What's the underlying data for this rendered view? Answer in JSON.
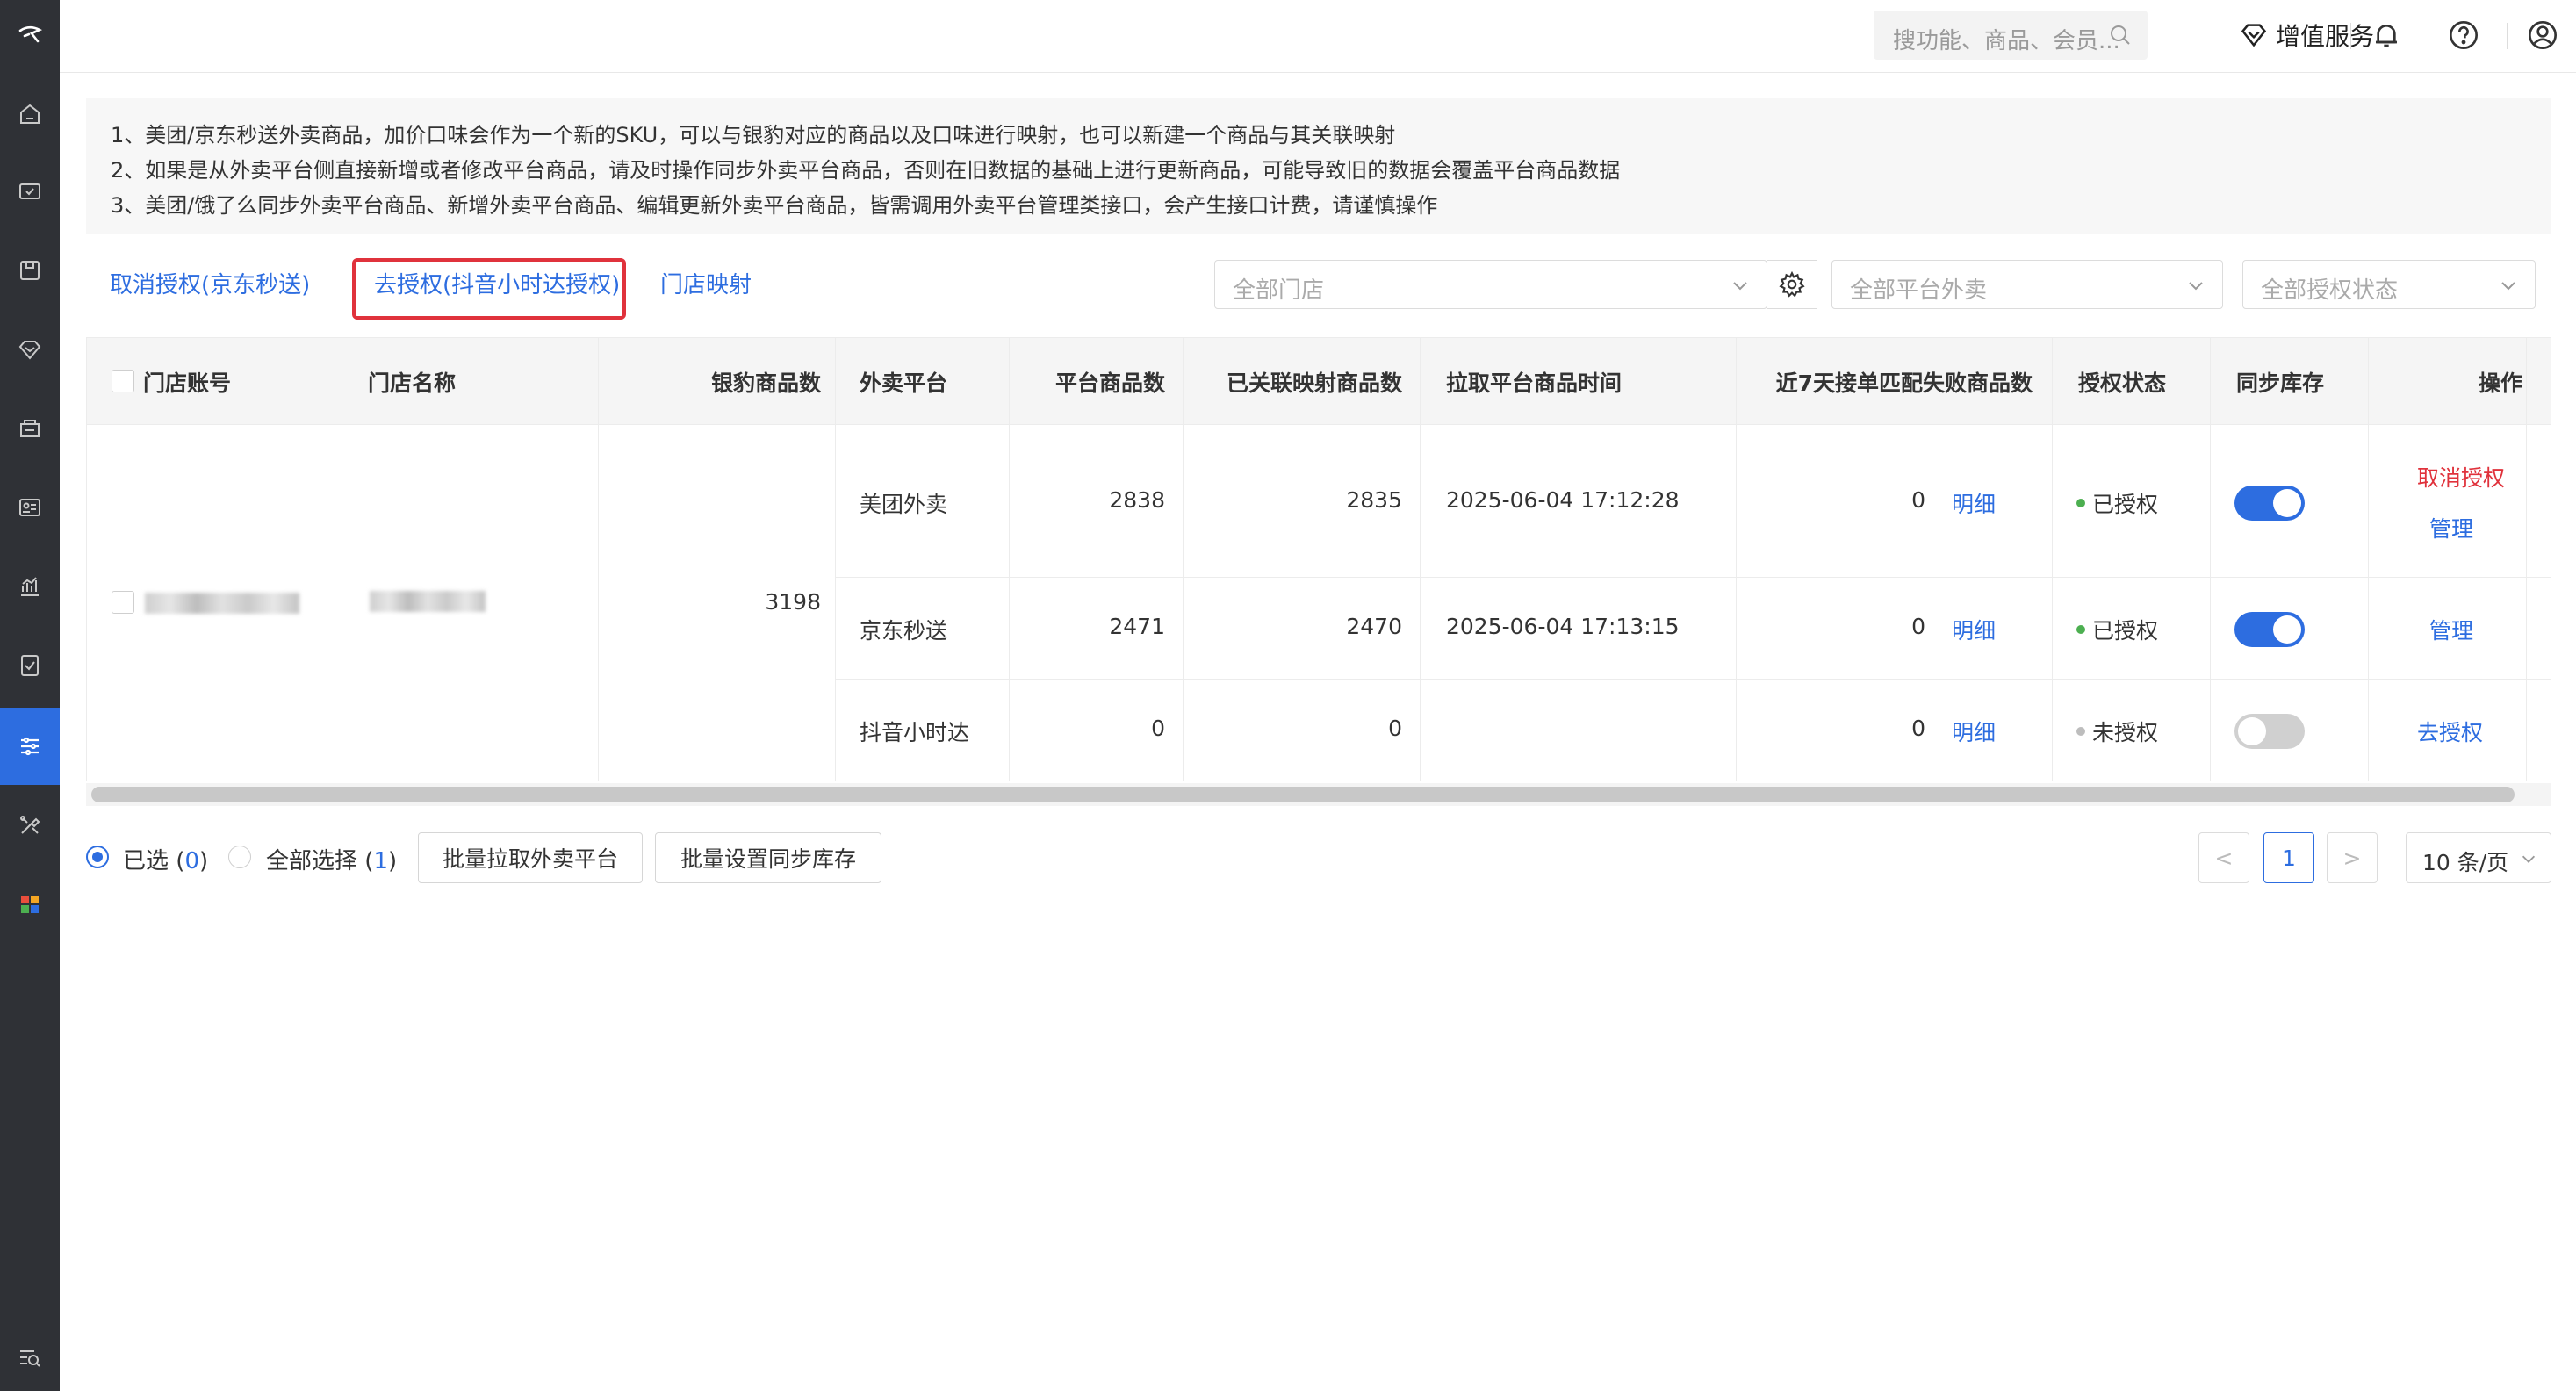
{
  "topbar": {
    "search_placeholder": "搜功能、商品、会员...",
    "value_added_label": "增值服务"
  },
  "notice": {
    "lines": [
      "1、美团/京东秒送外卖商品，加价口味会作为一个新的SKU，可以与银豹对应的商品以及口味进行映射，也可以新建一个商品与其关联映射",
      "2、如果是从外卖平台侧直接新增或者修改平台商品，请及时操作同步外卖平台商品，否则在旧数据的基础上进行更新商品，可能导致旧的数据会覆盖平台商品数据",
      "3、美团/饿了么同步外卖平台商品、新增外卖平台商品、编辑更新外卖平台商品，皆需调用外卖平台管理类接口，会产生接口计费，请谨慎操作"
    ]
  },
  "actions": {
    "cancel_auth_jd": "取消授权(京东秒送)",
    "auth_douyin": "去授权(抖音小时达授权)",
    "store_mapping": "门店映射"
  },
  "filters": {
    "store": "全部门店",
    "platform": "全部平台外卖",
    "auth_status": "全部授权状态"
  },
  "table": {
    "headers": [
      "门店账号",
      "门店名称",
      "银豹商品数",
      "外卖平台",
      "平台商品数",
      "已关联映射商品数",
      "拉取平台商品时间",
      "近7天接单匹配失败商品数",
      "授权状态",
      "同步库存",
      "操作"
    ],
    "store_product_count": "3198",
    "detail_label": "明细",
    "rows": [
      {
        "platform": "美团外卖",
        "platform_count": "2838",
        "mapped_count": "2835",
        "pull_time": "2025-06-04 17:12:28",
        "fail_count": "0",
        "status": "已授权",
        "sync": true,
        "ops": [
          "取消授权",
          "管理"
        ]
      },
      {
        "platform": "京东秒送",
        "platform_count": "2471",
        "mapped_count": "2470",
        "pull_time": "2025-06-04 17:13:15",
        "fail_count": "0",
        "status": "已授权",
        "sync": true,
        "ops": [
          "管理"
        ]
      },
      {
        "platform": "抖音小时达",
        "platform_count": "0",
        "mapped_count": "0",
        "pull_time": "",
        "fail_count": "0",
        "status": "未授权",
        "sync": false,
        "ops": [
          "去授权"
        ]
      }
    ]
  },
  "footer": {
    "selected_label": "已选",
    "selected_count": "0",
    "select_all_label": "全部选择",
    "select_all_count": "1",
    "batch_pull": "批量拉取外卖平台",
    "batch_sync": "批量设置同步库存",
    "prev": "<",
    "page": "1",
    "next": ">",
    "page_size": "10 条/页"
  },
  "colors": {
    "primary": "#2d6de0",
    "danger": "#e0323c",
    "sidebar": "#2f3136",
    "authorized_dot": "#4caf50",
    "unauthorized_dot": "#bdbdbd"
  }
}
